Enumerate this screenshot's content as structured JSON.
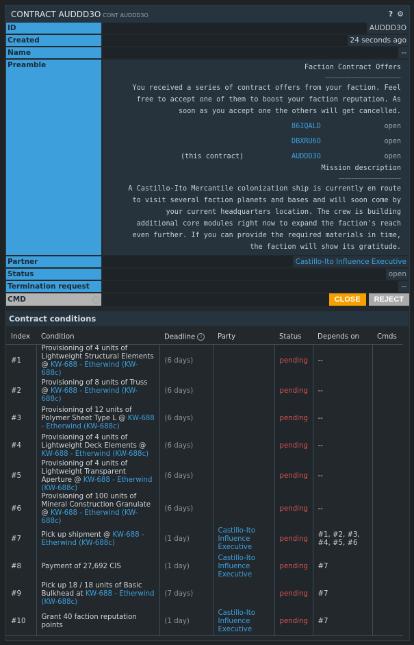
{
  "title": {
    "main": "CONTRACT AUDDD3O",
    "sub": "CONT AUDDD3O"
  },
  "icons": {
    "help": "?",
    "settings": "⚙"
  },
  "props": {
    "id": {
      "label": "ID",
      "value": "AUDDD3O"
    },
    "created": {
      "label": "Created",
      "value": "24 seconds ago"
    },
    "name": {
      "label": "Name",
      "value": "--"
    },
    "preamble": {
      "label": "Preamble",
      "heading": "Faction Contract Offers",
      "tilde1": "~~~~~~~~~~~~~~~~~~~~~~~",
      "intro_lines": [
        "You received a series of contract offers from your faction. Feel",
        "free to accept one of them to boost your faction reputation. As",
        "soon as you accept one the others will get cancelled."
      ],
      "offers": [
        {
          "note": "",
          "id": "86IQALD",
          "status": "open"
        },
        {
          "note": "",
          "id": "DBXRU6O",
          "status": "open"
        },
        {
          "note": "(this contract)",
          "id": "AUDDD3O",
          "status": "open"
        }
      ],
      "mission_heading": "Mission description",
      "tilde2": "~~~~~~~~~~~~~~~~~~~",
      "mission_lines": [
        "A Castillo-Ito Mercantile colonization ship is currently en route",
        "to visit several faction planets and bases and will soon come by",
        "your current headquarters location. The crew is building",
        "additional core modules right now to expand the faction's reach",
        "even further. If you can provide the required materials in time,",
        "the faction will show its gratitude."
      ]
    },
    "partner": {
      "label": "Partner",
      "value": "Castillo-Ito Influence Executive"
    },
    "status": {
      "label": "Status",
      "value": "open"
    },
    "termination": {
      "label": "Termination request",
      "value": "--"
    },
    "cmd": {
      "label": "CMD",
      "close": "CLOSE",
      "reject": "REJECT"
    }
  },
  "conditions": {
    "title": "Contract conditions",
    "headers": [
      "Index",
      "Condition",
      "Deadline",
      "Party",
      "Status",
      "Depends on",
      "Cmds"
    ],
    "rows": [
      {
        "index": "#1",
        "text": "Provisioning of 4 units of Lightweight Structural Elements @ ",
        "link": "KW-688 - Etherwind (KW-688c)",
        "deadline": "(6 days)",
        "party": "",
        "status": "pending",
        "depends": "--"
      },
      {
        "index": "#2",
        "text": "Provisioning of 8 units of Truss @ ",
        "link": "KW-688 - Etherwind (KW-688c)",
        "deadline": "(6 days)",
        "party": "",
        "status": "pending",
        "depends": "--"
      },
      {
        "index": "#3",
        "text": "Provisioning of 12 units of Polymer Sheet Type L @ ",
        "link": "KW-688 - Etherwind (KW-688c)",
        "deadline": "(6 days)",
        "party": "",
        "status": "pending",
        "depends": "--"
      },
      {
        "index": "#4",
        "text": "Provisioning of 4 units of Lightweight Deck Elements @ ",
        "link": "KW-688 - Etherwind (KW-688c)",
        "deadline": "(6 days)",
        "party": "",
        "status": "pending",
        "depends": "--"
      },
      {
        "index": "#5",
        "text": "Provisioning of 4 units of Lightweight Transparent Aperture @ ",
        "link": "KW-688 - Etherwind (KW-688c)",
        "deadline": "(6 days)",
        "party": "",
        "status": "pending",
        "depends": "--"
      },
      {
        "index": "#6",
        "text": "Provisioning of 100 units of Mineral Construction Granulate @ ",
        "link": "KW-688 - Etherwind (KW-688c)",
        "deadline": "(6 days)",
        "party": "",
        "status": "pending",
        "depends": "--"
      },
      {
        "index": "#7",
        "text": "Pick up shipment @ ",
        "link": "KW-688 - Etherwind (KW-688c)",
        "deadline": "(1 day)",
        "party": "Castillo-Ito Influence Executive",
        "status": "pending",
        "depends": "#1, #2, #3, #4, #5, #6"
      },
      {
        "index": "#8",
        "text": "Payment of 27,692 CIS",
        "link": "",
        "deadline": "(1 day)",
        "party": "Castillo-Ito Influence Executive",
        "status": "pending",
        "depends": "#7"
      },
      {
        "index": "#9",
        "text": "Pick up 18 / 18 units of Basic Bulkhead at ",
        "link": "KW-688 - Etherwind (KW-688c)",
        "deadline": "(7 days)",
        "party": "",
        "status": "pending",
        "depends": "#7"
      },
      {
        "index": "#10",
        "text": "Grant 40 faction reputation points",
        "link": "",
        "deadline": "(1 day)",
        "party": "Castillo-Ito Influence Executive",
        "status": "pending",
        "depends": "#7"
      }
    ]
  }
}
